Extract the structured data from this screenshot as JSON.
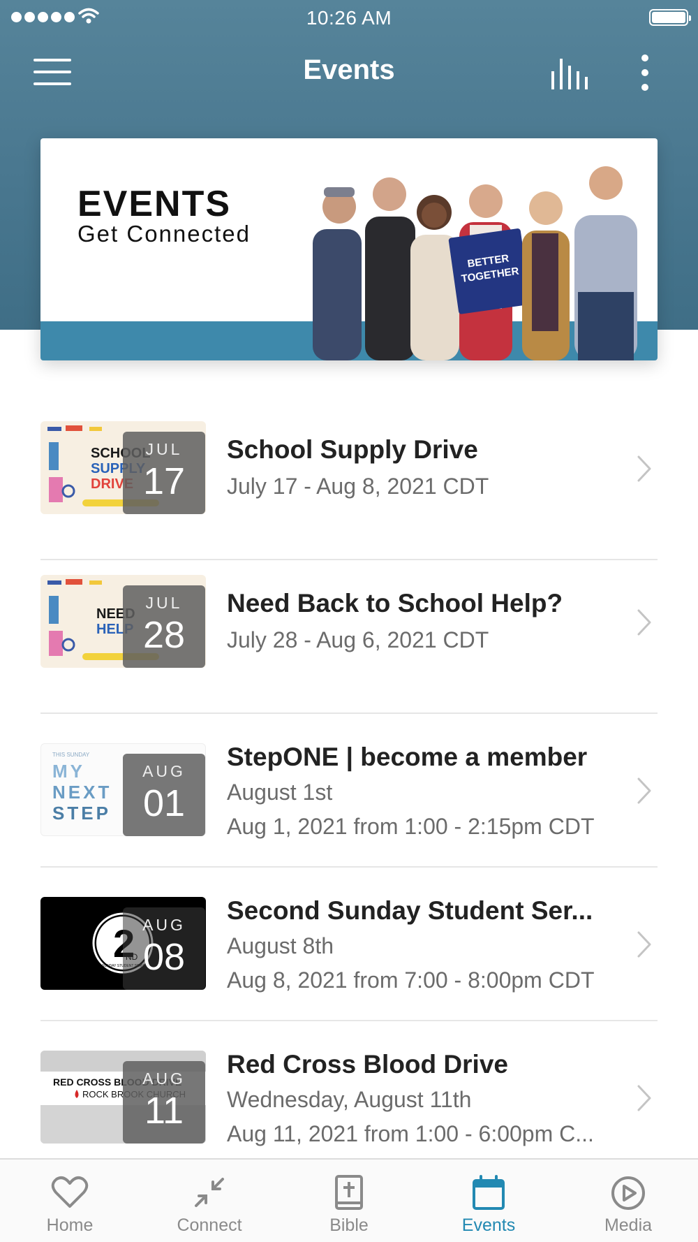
{
  "status_bar": {
    "time": "10:26 AM"
  },
  "nav": {
    "title": "Events"
  },
  "banner": {
    "title": "EVENTS",
    "subtitle": "Get Connected",
    "sign_text": "BETTER TOGETHER"
  },
  "events": [
    {
      "title": "School Supply Drive",
      "lines": [
        "July 17 - Aug 8, 2021 CDT"
      ],
      "month": "JUL",
      "day": "17",
      "thumb_text": [
        "SCHOOL",
        "SUPPLY",
        "DRIVE"
      ]
    },
    {
      "title": "Need Back to School Help?",
      "lines": [
        "July 28 - Aug 6, 2021 CDT"
      ],
      "month": "JUL",
      "day": "28",
      "thumb_text": [
        "NEED",
        "HELP"
      ]
    },
    {
      "title": "StepONE | become a member",
      "lines": [
        "August 1st",
        "Aug 1, 2021 from 1:00 - 2:15pm CDT"
      ],
      "month": "AUG",
      "day": "01",
      "thumb_text": [
        "THIS SUNDAY",
        "MY",
        "NEXT",
        "STEP"
      ]
    },
    {
      "title": "Second Sunday Student Ser...",
      "lines": [
        "August 8th",
        "Aug 8, 2021 from 7:00 - 8:00pm CDT"
      ],
      "month": "AUG",
      "day": "08",
      "thumb_text": [
        "2",
        "ND",
        "SUNDAY STUDENT SERVICE"
      ]
    },
    {
      "title": "Red Cross Blood Drive",
      "lines": [
        "Wednesday, August 11th",
        "Aug 11, 2021 from 1:00 - 6:00pm C..."
      ],
      "month": "AUG",
      "day": "11",
      "thumb_text": [
        "RED CROSS BLOOD DRIVE",
        "ROCK BROOK CHURCH"
      ]
    }
  ],
  "tabs": [
    {
      "label": "Home",
      "icon": "heart-icon"
    },
    {
      "label": "Connect",
      "icon": "compress-arrows-icon"
    },
    {
      "label": "Bible",
      "icon": "bible-icon"
    },
    {
      "label": "Events",
      "icon": "calendar-icon",
      "active": true
    },
    {
      "label": "Media",
      "icon": "play-circle-icon"
    }
  ],
  "colors": {
    "header": "#4a7890",
    "accent": "#2289b2",
    "banner_strip": "#3e89ab"
  }
}
